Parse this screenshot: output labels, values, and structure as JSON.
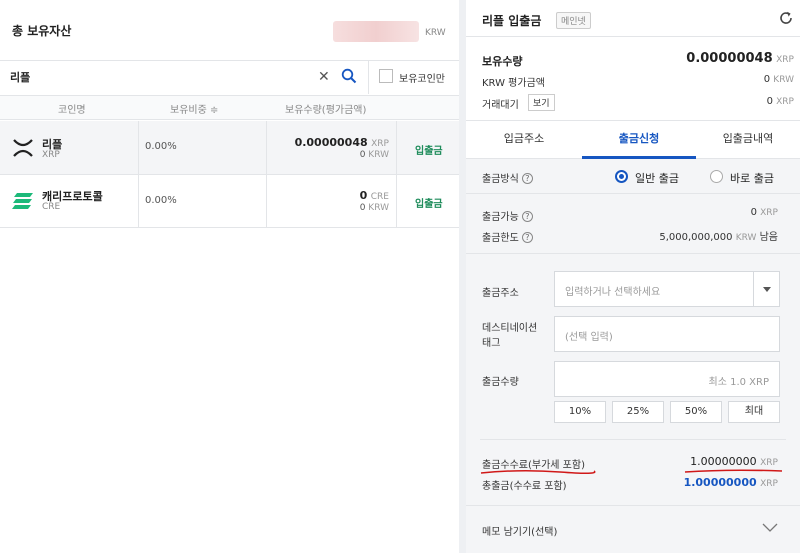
{
  "left": {
    "title": "총 보유자산",
    "total_unit": "KRW",
    "search": {
      "value": "리플"
    },
    "owned_only_label": "보유코인만",
    "columns": {
      "coin": "코인명",
      "share": "보유비중 ≑",
      "holding": "보유수량(평가금액)"
    },
    "rows": [
      {
        "name": "리플",
        "symbol": "XRP",
        "share": "0.00%",
        "amount": "0.00000048",
        "amount_unit": "XRP",
        "krw": "0",
        "krw_unit": "KRW",
        "action": "입출금"
      },
      {
        "name": "캐리프로토콜",
        "symbol": "CRE",
        "share": "0.00%",
        "amount": "0",
        "amount_unit": "CRE",
        "krw": "0",
        "krw_unit": "KRW",
        "action": "입출금"
      }
    ]
  },
  "right": {
    "title": "리플 입출금",
    "badge": "메인넷",
    "holdings": {
      "label": "보유수량",
      "value": "0.00000048",
      "unit": "XRP",
      "krw_label": "KRW 평가금액",
      "krw_value": "0",
      "krw_unit": "KRW",
      "pending_label": "거래대기",
      "view_label": "보기",
      "pending_value": "0",
      "pending_unit": "XRP"
    },
    "tabs": [
      "입금주소",
      "출금신청",
      "입출금내역"
    ],
    "active_tab": 1,
    "method": {
      "label": "출금방식",
      "option1": "일반 출금",
      "option2": "바로 출금"
    },
    "available": {
      "label": "출금가능",
      "value": "0",
      "unit": "XRP"
    },
    "limit": {
      "label": "출금한도",
      "value": "5,000,000,000",
      "unit": "KRW",
      "suffix": "남음"
    },
    "address": {
      "label": "출금주소",
      "placeholder": "입력하거나 선택하세요"
    },
    "tag": {
      "label1": "데스티네이션",
      "label2": "태그",
      "placeholder": "(선택 입력)"
    },
    "amount": {
      "label": "출금수량",
      "placeholder": "최소 1.0 XRP"
    },
    "pct_buttons": [
      "10%",
      "25%",
      "50%",
      "최대"
    ],
    "fee": {
      "label": "출금수수료(부가세 포함)",
      "value": "1.00000000",
      "unit": "XRP"
    },
    "total": {
      "label": "총출금(수수료 포함)",
      "value": "1.00000000",
      "unit": "XRP"
    },
    "memo": {
      "label": "메모 남기기(선택)"
    },
    "colors": {
      "accent": "#1656c1",
      "green": "#1e8c5b",
      "underline": "#d01818"
    }
  }
}
